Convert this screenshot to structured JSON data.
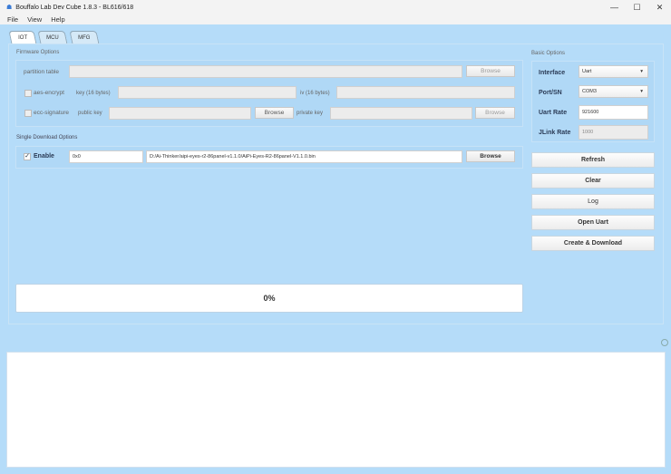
{
  "window": {
    "title": "Bouffalo Lab Dev Cube 1.8.3 - BL616/618",
    "minimize": "—",
    "maximize": "☐",
    "close": "✕"
  },
  "menu": [
    "File",
    "View",
    "Help"
  ],
  "tabs": [
    "IOT",
    "MCU",
    "MFG"
  ],
  "firmware": {
    "title": "Firmware Options",
    "partition_label": "partition table",
    "browse": "Browse",
    "aes_label": "aes-encrypt",
    "key_label": "key (16 bytes)",
    "iv_label": "iv (16 bytes)",
    "ecc_label": "ecc-signature",
    "pubkey_label": "public key",
    "privkey_label": "private key"
  },
  "single": {
    "title": "Single Download Options",
    "enable_label": "Enable",
    "address": "0x0",
    "path": "D:/Ai-Thinker/aipi-eyes-r2-86panel-v1.1.0/AiPi-Eyes-R2-86panel-V1.1.0.bin",
    "browse": "Browse",
    "checked": true
  },
  "progress": {
    "text": "0%",
    "value": 0
  },
  "basic": {
    "title": "Basic Options",
    "interface_label": "Interface",
    "interface_value": "Uart",
    "port_label": "Port/SN",
    "port_value": "COM3",
    "uart_label": "Uart Rate",
    "uart_value": "921600",
    "jlink_label": "JLink Rate",
    "jlink_value": "1000"
  },
  "buttons": {
    "refresh": "Refresh",
    "clear": "Clear",
    "log": "Log",
    "open_uart": "Open Uart",
    "create": "Create & Download"
  }
}
